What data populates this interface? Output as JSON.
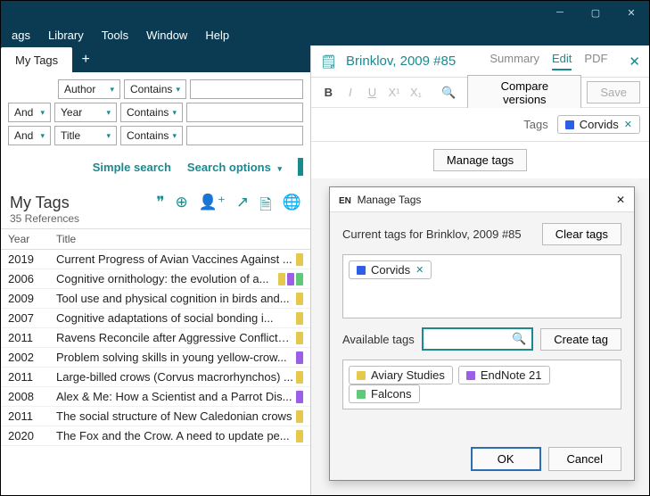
{
  "menubar": {
    "items": [
      "ags",
      "Library",
      "Tools",
      "Window",
      "Help"
    ]
  },
  "tab": {
    "label": "My Tags"
  },
  "search": {
    "rows": [
      {
        "bool": "",
        "field": "Author",
        "op": "Contains"
      },
      {
        "bool": "And",
        "field": "Year",
        "op": "Contains"
      },
      {
        "bool": "And",
        "field": "Title",
        "op": "Contains"
      }
    ],
    "simple": "Simple search",
    "options": "Search options"
  },
  "group": {
    "title": "My Tags",
    "count": "35 References"
  },
  "columns": {
    "year": "Year",
    "title": "Title"
  },
  "refs": [
    {
      "year": "2019",
      "title": "Current Progress of Avian Vaccines Against ...",
      "tags": [
        "#e6c94c"
      ]
    },
    {
      "year": "2006",
      "title": "Cognitive ornithology: the evolution of a...",
      "tags": [
        "#e6c94c",
        "#9a5fe6",
        "#5fc97a"
      ]
    },
    {
      "year": "2009",
      "title": "Tool use and physical cognition in birds and...",
      "tags": [
        "#e6c94c"
      ]
    },
    {
      "year": "2007",
      "title": "Cognitive adaptations of social bonding i...",
      "tags": [
        "#e6c94c"
      ]
    },
    {
      "year": "2011",
      "title": "Ravens Reconcile after Aggressive Conflicts ...",
      "tags": [
        "#e6c94c"
      ]
    },
    {
      "year": "2002",
      "title": "Problem solving skills in young yellow-crow...",
      "tags": [
        "#9a5fe6"
      ]
    },
    {
      "year": "2011",
      "title": "Large-billed crows (Corvus macrorhynchos) ...",
      "tags": [
        "#e6c94c"
      ]
    },
    {
      "year": "2008",
      "title": "Alex & Me: How a Scientist and a Parrot Dis...",
      "tags": [
        "#9a5fe6"
      ]
    },
    {
      "year": "2011",
      "title": "The social structure of New Caledonian crows",
      "tags": [
        "#e6c94c"
      ]
    },
    {
      "year": "2020",
      "title": "The Fox and the Crow. A need to update pe...",
      "tags": [
        "#e6c94c"
      ]
    }
  ],
  "ref": {
    "title": "Brinklov, 2009 #85",
    "tabs": {
      "summary": "Summary",
      "edit": "Edit",
      "pdf": "PDF"
    },
    "tags_label": "Tags",
    "current_tag": {
      "name": "Corvids",
      "color": "#2d5fe6"
    },
    "manage_btn": "Manage tags",
    "compare": "Compare versions",
    "save": "Save"
  },
  "dialog": {
    "title": "Manage Tags",
    "current_label": "Current tags for Brinklov, 2009 #85",
    "clear": "Clear tags",
    "available_label": "Available tags",
    "create": "Create tag",
    "available": [
      {
        "name": "Aviary Studies",
        "color": "#e6c94c"
      },
      {
        "name": "EndNote 21",
        "color": "#9a5fe6"
      },
      {
        "name": "Falcons",
        "color": "#5fc97a"
      }
    ],
    "ok": "OK",
    "cancel": "Cancel"
  }
}
